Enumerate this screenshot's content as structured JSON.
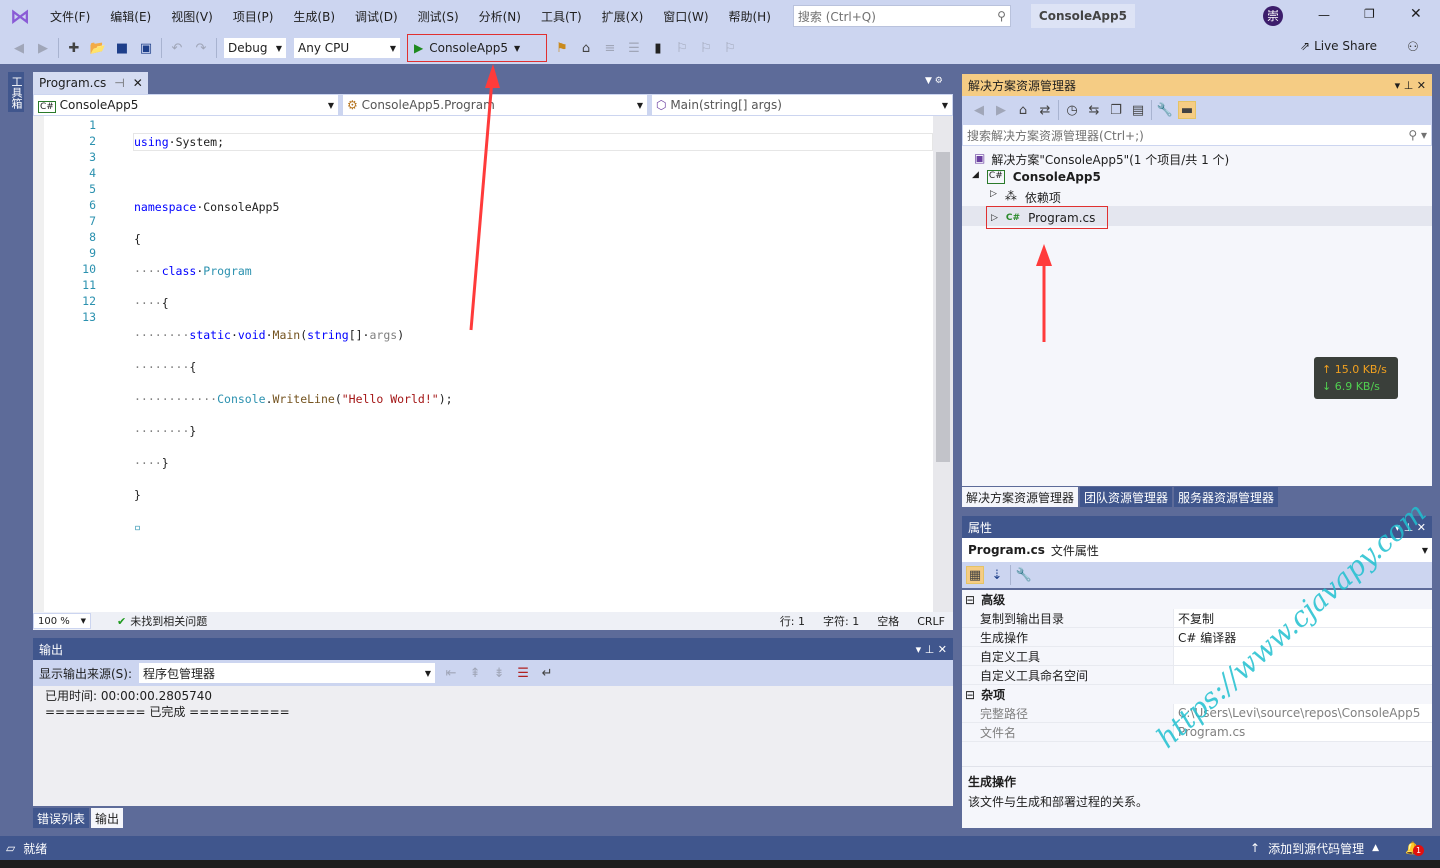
{
  "menubar": {
    "items": [
      "文件(F)",
      "编辑(E)",
      "视图(V)",
      "项目(P)",
      "生成(B)",
      "调试(D)",
      "测试(S)",
      "分析(N)",
      "工具(T)",
      "扩展(X)",
      "窗口(W)",
      "帮助(H)"
    ],
    "search_placeholder": "搜索 (Ctrl+Q)",
    "solution_name": "ConsoleApp5",
    "avatar": "崇"
  },
  "toolbar": {
    "config": "Debug",
    "platform": "Any CPU",
    "run_target": "ConsoleApp5",
    "live_share": "Live Share"
  },
  "left_strip": {
    "label": "工具箱"
  },
  "editor": {
    "tab": "Program.cs",
    "nav_project": "ConsoleApp5",
    "nav_class": "ConsoleApp5.Program",
    "nav_member": "Main(string[] args)",
    "zoom": "100 %",
    "issues": "未找到相关问题",
    "line": "行: 1",
    "char": "字符: 1",
    "spaces": "空格",
    "eol": "CRLF",
    "lines": [
      "1",
      "2",
      "3",
      "4",
      "5",
      "6",
      "7",
      "8",
      "9",
      "10",
      "11",
      "12",
      "13"
    ],
    "code": {
      "using": "using",
      "system": "System;",
      "namespace": "namespace",
      "ns": "ConsoleApp5",
      "class": "class",
      "cls": "Program",
      "static": "static",
      "void": "void",
      "main": "Main",
      "string": "string",
      "args": "args",
      "console": "Console",
      "writeline": "WriteLine",
      "hello": "\"Hello World!\""
    }
  },
  "output": {
    "title": "输出",
    "source_label": "显示输出来源(S):",
    "source": "程序包管理器",
    "line1": "已用时间: 00:00:00.2805740",
    "line2": "========== 已完成 ==========",
    "tabs": [
      "错误列表",
      "输出"
    ]
  },
  "solution_explorer": {
    "title": "解决方案资源管理器",
    "search_placeholder": "搜索解决方案资源管理器(Ctrl+;)",
    "solution": "解决方案\"ConsoleApp5\"(1 个项目/共 1 个)",
    "project": "ConsoleApp5",
    "deps": "依赖项",
    "file": "Program.cs",
    "tabs": [
      "解决方案资源管理器",
      "团队资源管理器",
      "服务器资源管理器"
    ]
  },
  "network": {
    "up": "15.0 KB/s",
    "down": "6.9 KB/s"
  },
  "properties": {
    "title": "属性",
    "object": "Program.cs",
    "object_type": "文件属性",
    "categories": [
      {
        "name": "高级",
        "rows": [
          {
            "k": "复制到输出目录",
            "v": "不复制"
          },
          {
            "k": "生成操作",
            "v": "C# 编译器"
          },
          {
            "k": "自定义工具",
            "v": ""
          },
          {
            "k": "自定义工具命名空间",
            "v": ""
          }
        ]
      },
      {
        "name": "杂项",
        "rows": [
          {
            "k": "完整路径",
            "v": "C:\\Users\\Levi\\source\\repos\\ConsoleApp5"
          },
          {
            "k": "文件名",
            "v": "Program.cs"
          }
        ]
      }
    ],
    "desc_title": "生成操作",
    "desc": "该文件与生成和部署过程的关系。"
  },
  "statusbar": {
    "ready": "就绪",
    "source_control": "添加到源代码管理",
    "notifications": "1"
  },
  "watermark": "https://www.cjavapy.com",
  "colors": {
    "accent": "#40568d",
    "highlight": "#f5cc84",
    "annotation": "#ff3b3b"
  }
}
